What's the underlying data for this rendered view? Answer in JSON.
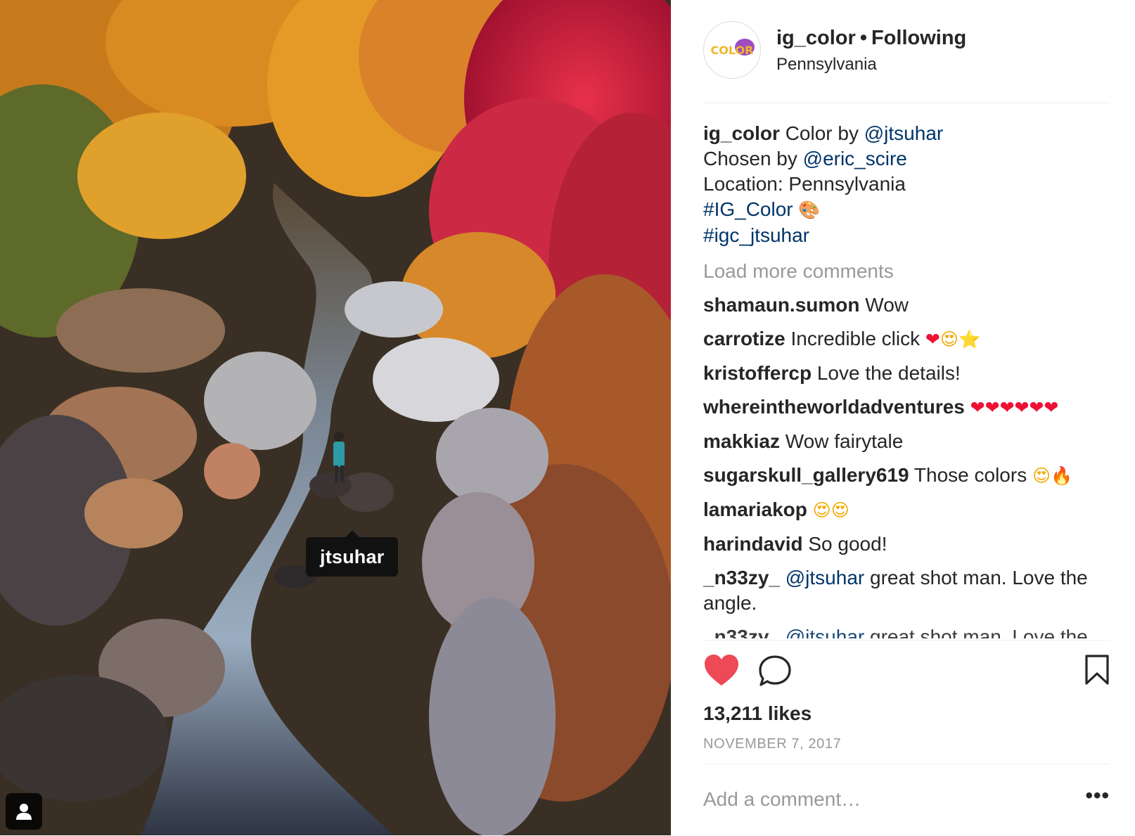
{
  "photo": {
    "tag_label": "jtsuhar",
    "icons": {
      "tag_toggle": "person-icon"
    }
  },
  "header": {
    "username": "ig_color",
    "separator": "•",
    "follow_status": "Following",
    "location": "Pennsylvania",
    "avatar_text": "COLOR"
  },
  "caption": {
    "username": "ig_color",
    "text1": "Color by ",
    "mention1": "@jtsuhar",
    "line2_text": "Chosen by ",
    "mention2": "@eric_scire",
    "line3": "Location: Pennsylvania",
    "hashtag1": "#IG_Color",
    "hashtag1_emoji": "🎨",
    "hashtag2": "#igc_jtsuhar"
  },
  "load_more": "Load more comments",
  "comments": [
    {
      "user": "shamaun.sumon",
      "text": "Wow"
    },
    {
      "user": "carrotize",
      "text": "Incredible click",
      "emoji": [
        "❤",
        "😍",
        "⭐"
      ]
    },
    {
      "user": "kristoffercp",
      "text": "Love the details!"
    },
    {
      "user": "whereintheworldadventures",
      "emoji": [
        "❤",
        "❤",
        "❤",
        "❤",
        "❤",
        "❤"
      ]
    },
    {
      "user": "makkiaz",
      "text": "Wow fairytale"
    },
    {
      "user": "sugarskull_gallery619",
      "text": "Those colors",
      "emoji": [
        "😍",
        "🔥"
      ]
    },
    {
      "user": "lamariakop",
      "emoji": [
        "😍",
        "😍"
      ]
    },
    {
      "user": "harindavid",
      "text": "So good!"
    },
    {
      "user": "_n33zy_",
      "mention": "@jtsuhar",
      "text": "great shot man. Love the angle."
    },
    {
      "user": "_n33zy_",
      "mention": "@jtsuhar",
      "text": "great shot man. Love the"
    }
  ],
  "actions": {
    "likes": "13,211 likes",
    "date": "NOVEMBER 7, 2017",
    "icons": {
      "like": "heart-icon",
      "comment": "comment-icon",
      "save": "bookmark-icon"
    },
    "like_color": "#ed4956"
  },
  "add_comment": {
    "placeholder": "Add a comment…",
    "more": "•••"
  }
}
